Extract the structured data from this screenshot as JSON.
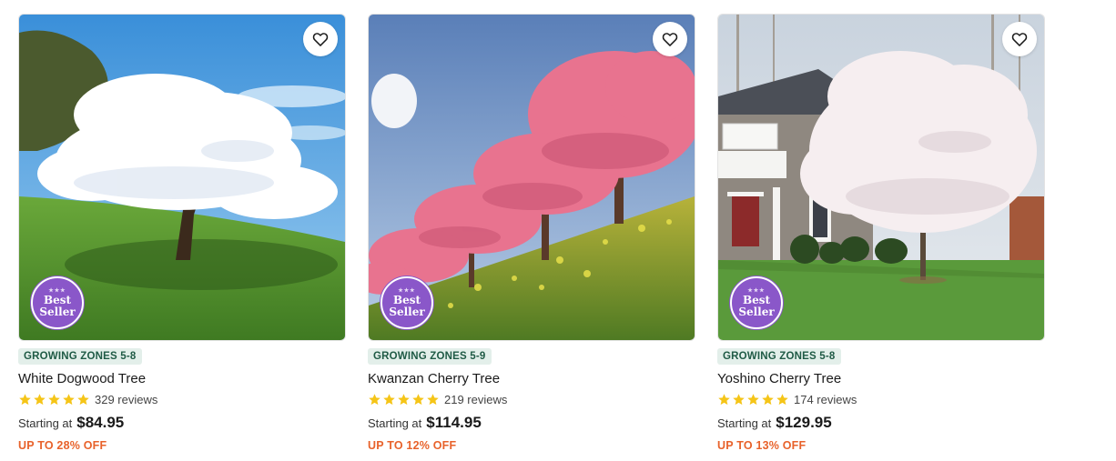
{
  "products": [
    {
      "zone": "GROWING ZONES 5-8",
      "name": "White Dogwood Tree",
      "rating": 5,
      "reviews": "329 reviews",
      "starting_label": "Starting at",
      "price": "$84.95",
      "discount": "UP TO 28% OFF",
      "badge_line1": "Best",
      "badge_line2": "Seller",
      "blossom_color": "#ffffff",
      "favorite_icon": "heart-outline-icon"
    },
    {
      "zone": "GROWING ZONES 5-9",
      "name": "Kwanzan Cherry Tree",
      "rating": 5,
      "reviews": "219 reviews",
      "starting_label": "Starting at",
      "price": "$114.95",
      "discount": "UP TO 12% OFF",
      "badge_line1": "Best",
      "badge_line2": "Seller",
      "blossom_color": "#e8738f",
      "favorite_icon": "heart-outline-icon"
    },
    {
      "zone": "GROWING ZONES 5-8",
      "name": "Yoshino Cherry Tree",
      "rating": 5,
      "reviews": "174 reviews",
      "starting_label": "Starting at",
      "price": "$129.95",
      "discount": "UP TO 13% OFF",
      "badge_line1": "Best",
      "badge_line2": "Seller",
      "blossom_color": "#f6eef0",
      "favorite_icon": "heart-outline-icon"
    }
  ],
  "colors": {
    "zone_bg": "#e3efea",
    "zone_text": "#1f5a45",
    "star": "#f5c518",
    "discount": "#e8622b",
    "badge": "#8a57c9"
  }
}
